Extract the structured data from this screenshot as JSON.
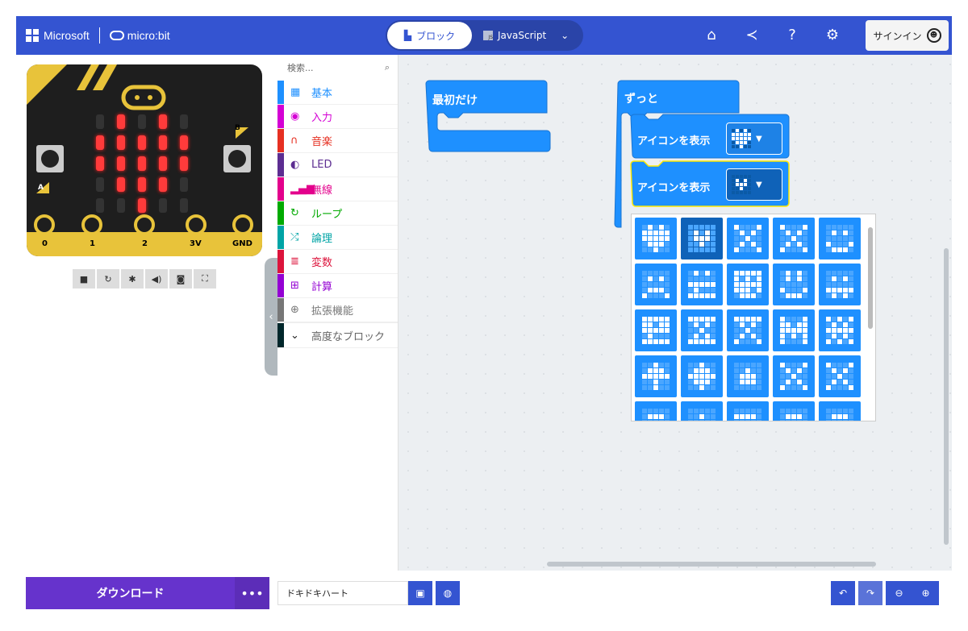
{
  "brand": {
    "microsoft": "Microsoft",
    "product": "micro:bit"
  },
  "editor_toggle": {
    "blocks": "ブロック",
    "javascript": "JavaScript",
    "js_badge": "JS"
  },
  "header_icons": [
    "home-icon",
    "share-icon",
    "help-icon",
    "settings-icon"
  ],
  "signin": "サインイン",
  "simulator": {
    "pins": [
      "0",
      "1",
      "2",
      "3V",
      "GND"
    ],
    "button_a": "A",
    "button_b": "B",
    "controls": [
      "stop-icon",
      "restart-icon",
      "debug-icon",
      "mute-icon",
      "screenshot-icon",
      "fullscreen-icon"
    ],
    "leds": [
      [
        0,
        1,
        0,
        1,
        0
      ],
      [
        1,
        1,
        1,
        1,
        1
      ],
      [
        1,
        1,
        1,
        1,
        1
      ],
      [
        0,
        1,
        1,
        1,
        0
      ],
      [
        0,
        0,
        1,
        0,
        0
      ]
    ]
  },
  "toolbox": {
    "search_placeholder": "検索...",
    "categories": [
      {
        "label": "基本",
        "icon": "grid-icon",
        "color": "#1e90ff"
      },
      {
        "label": "入力",
        "icon": "circle-icon",
        "color": "#d400d4"
      },
      {
        "label": "音楽",
        "icon": "headphones-icon",
        "color": "#e63022"
      },
      {
        "label": "LED",
        "icon": "toggle-icon",
        "color": "#5c2d91"
      },
      {
        "label": "無線",
        "icon": "signal-icon",
        "color": "#e3008c"
      },
      {
        "label": "ループ",
        "icon": "loop-icon",
        "color": "#00aa00"
      },
      {
        "label": "論理",
        "icon": "shuffle-icon",
        "color": "#00a4a6"
      },
      {
        "label": "変数",
        "icon": "list-icon",
        "color": "#dc143c"
      },
      {
        "label": "計算",
        "icon": "calculator-icon",
        "color": "#9400d3"
      },
      {
        "label": "拡張機能",
        "icon": "plus-icon",
        "color": "#777777"
      }
    ],
    "advanced": "高度なブロック"
  },
  "canvas": {
    "on_start": "最初だけ",
    "forever": "ずっと",
    "show_icon_1": "アイコンを表示",
    "show_icon_2": "アイコンを表示"
  },
  "bottom": {
    "download": "ダウンロード",
    "more": "•••",
    "project_name": "ドキドキハート"
  }
}
